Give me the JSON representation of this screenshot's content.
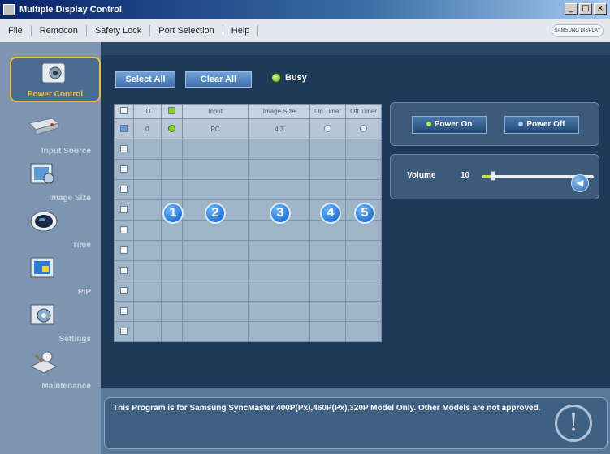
{
  "window": {
    "title": "Multiple Display Control",
    "controls": [
      "_",
      "□",
      "×"
    ]
  },
  "menu": {
    "items": [
      "File",
      "Remocon",
      "Safety Lock",
      "Port Selection",
      "Help"
    ],
    "brand": "SAMSUNG DISPLAY"
  },
  "sidebar": {
    "items": [
      {
        "label": "Power Control",
        "icon": "power-control-icon",
        "active": true
      },
      {
        "label": "Input Source",
        "icon": "input-source-icon"
      },
      {
        "label": "Image Size",
        "icon": "image-size-icon"
      },
      {
        "label": "Time",
        "icon": "time-icon"
      },
      {
        "label": "PIP",
        "icon": "pip-icon"
      },
      {
        "label": "Settings",
        "icon": "settings-icon"
      },
      {
        "label": "Maintenance",
        "icon": "maintenance-icon"
      }
    ]
  },
  "toolbar": {
    "select_all": "Select All",
    "clear_all": "Clear All",
    "busy": "Busy",
    "busy_color": "#5aa010"
  },
  "grid": {
    "headers": [
      "",
      "ID",
      "",
      "Input",
      "Image Size",
      "On Timer",
      "Off Timer"
    ],
    "first_row": {
      "id": "0",
      "input": "PC",
      "image_size": "4:3"
    },
    "empty_rows": 10
  },
  "callouts": [
    "1",
    "2",
    "3",
    "4",
    "5"
  ],
  "power": {
    "on_label": "Power On",
    "off_label": "Power Off",
    "on_color": "#b8f040",
    "off_color": "#a8c8e8"
  },
  "volume": {
    "label": "Volume",
    "value": "10",
    "level_fraction": 0.1
  },
  "message": "This Program is for Samsung SyncMaster 400P(Px),460P(Px),320P  Model Only. Other Models are not approved."
}
